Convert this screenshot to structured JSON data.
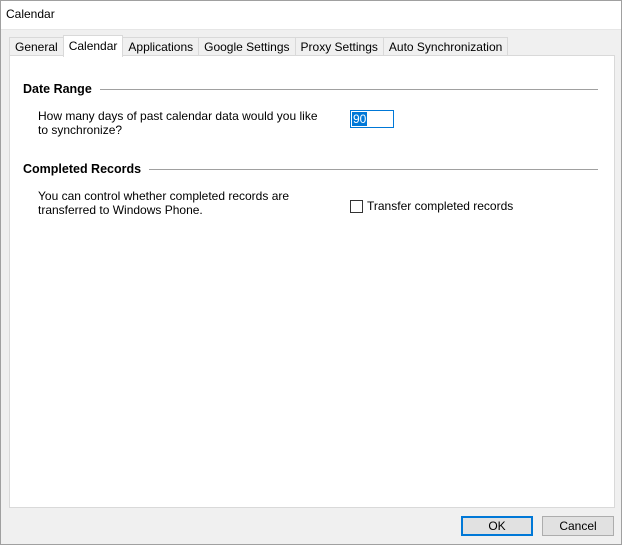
{
  "window": {
    "title": "Calendar"
  },
  "tabs": [
    {
      "label": "General"
    },
    {
      "label": "Calendar"
    },
    {
      "label": "Applications"
    },
    {
      "label": "Google Settings"
    },
    {
      "label": "Proxy Settings"
    },
    {
      "label": "Auto Synchronization"
    }
  ],
  "active_tab": "Calendar",
  "date_range": {
    "title": "Date Range",
    "question": "How many days of past calendar data would you like to synchronize?",
    "days_value": "90"
  },
  "completed_records": {
    "title": "Completed Records",
    "description": "You can control whether completed records are transferred to Windows Phone.",
    "checkbox_label": "Transfer completed records",
    "checkbox_checked": false
  },
  "buttons": {
    "ok": "OK",
    "cancel": "Cancel"
  },
  "colors": {
    "accent": "#0078d7"
  }
}
